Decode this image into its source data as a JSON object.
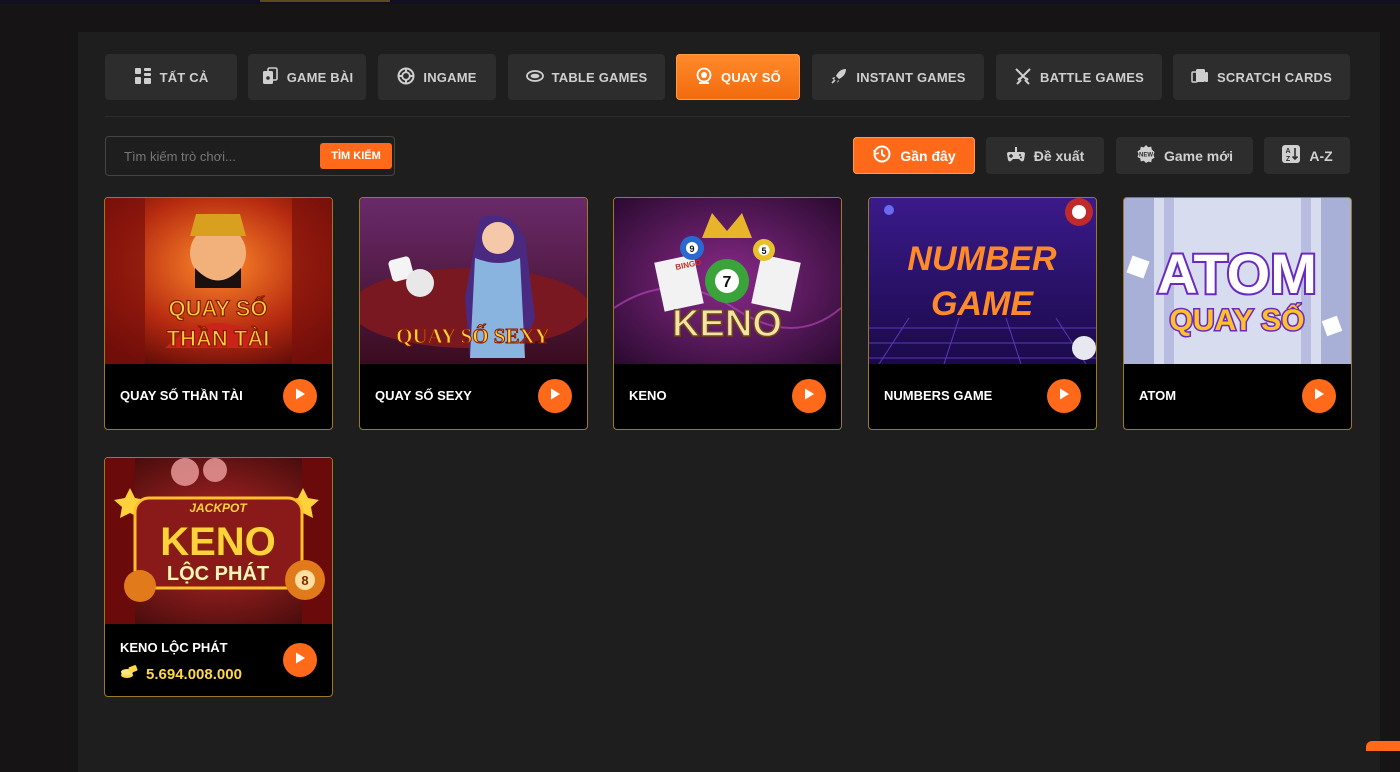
{
  "tabs": [
    {
      "label": "TẤT CẢ",
      "icon": "grid-icon"
    },
    {
      "label": "GAME BÀI",
      "icon": "cards-icon"
    },
    {
      "label": "INGAME",
      "icon": "chip-icon"
    },
    {
      "label": "TABLE GAMES",
      "icon": "table-icon"
    },
    {
      "label": "QUAY SỐ",
      "icon": "lottery-icon",
      "active": true
    },
    {
      "label": "INSTANT GAMES",
      "icon": "rocket-icon"
    },
    {
      "label": "BATTLE GAMES",
      "icon": "swords-icon"
    },
    {
      "label": "SCRATCH CARDS",
      "icon": "scratch-card-icon"
    }
  ],
  "search": {
    "placeholder": "Tìm kiếm trò chơi...",
    "button": "TÌM KIẾM"
  },
  "sort": [
    {
      "label": "Gần đây",
      "icon": "recent-icon",
      "active": true
    },
    {
      "label": "Đề xuất",
      "icon": "gamepad-icon"
    },
    {
      "label": "Game mới",
      "icon": "new-badge-icon"
    },
    {
      "label": "A-Z",
      "icon": "az-sort-icon"
    }
  ],
  "games": [
    {
      "name": "QUAY SỐ THẦN TÀI",
      "art_text": [
        "QUAY SỐ",
        "THẦN TÀI"
      ]
    },
    {
      "name": "QUAY SỐ SEXY",
      "art_text": [
        "QUAY SỐ SEXY"
      ]
    },
    {
      "name": "KENO",
      "art_text": [
        "KENO",
        "BINGO",
        "7",
        "9",
        "5"
      ]
    },
    {
      "name": "NUMBERS GAME",
      "art_text": [
        "NUMBER",
        "GAME"
      ]
    },
    {
      "name": "ATOM",
      "art_text": [
        "ATOM",
        "QUAY SỐ"
      ]
    },
    {
      "name": "KENO LỘC PHÁT",
      "art_text": [
        "JACKPOT",
        "KENO",
        "LỘC PHÁT",
        "8"
      ],
      "jackpot": "5.694.008.000"
    }
  ],
  "colors": {
    "accent": "#ff6a1a",
    "card_border": "#9c7a25",
    "panel": "#1e1e1e",
    "jackpot": "#ffd84a"
  }
}
